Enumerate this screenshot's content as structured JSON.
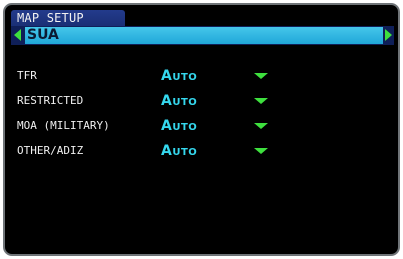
{
  "window": {
    "title": "MAP SETUP"
  },
  "selector": {
    "value": "SUA"
  },
  "rows": [
    {
      "label": "TFR",
      "value": "Auto"
    },
    {
      "label": "RESTRICTED",
      "value": "Auto"
    },
    {
      "label": "MOA (MILITARY)",
      "value": "Auto"
    },
    {
      "label": "OTHER/ADIZ",
      "value": "Auto"
    }
  ],
  "colors": {
    "title_bar": "#233b8c",
    "selector_field": "#2fb6e2",
    "value_text": "#35d8ee",
    "arrow": "#3ee03e",
    "border": "#6f7478"
  }
}
